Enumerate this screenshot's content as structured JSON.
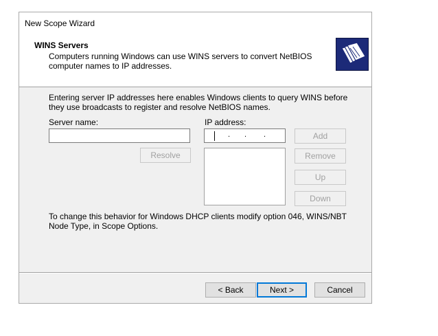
{
  "window": {
    "title": "New Scope Wizard"
  },
  "header": {
    "title": "WINS Servers",
    "description": "Computers running Windows can use WINS servers to convert NetBIOS computer names to IP addresses.",
    "icon": "folders-icon"
  },
  "body": {
    "intro": "Entering server IP addresses here enables Windows clients to query WINS before they use broadcasts to register and resolve NetBIOS names.",
    "server_name_label": "Server name:",
    "server_name_value": "",
    "ip_address_label": "IP address:",
    "ip_address_value": ". . .",
    "ip_list": [],
    "buttons": {
      "resolve": "Resolve",
      "add": "Add",
      "remove": "Remove",
      "up": "Up",
      "down": "Down"
    },
    "note": "To change this behavior for Windows DHCP clients modify option 046, WINS/NBT Node Type, in Scope Options."
  },
  "footer": {
    "back": "< Back",
    "next": "Next >",
    "cancel": "Cancel"
  },
  "colors": {
    "accent": "#0078d7",
    "icon_bg": "#1c2a78"
  }
}
